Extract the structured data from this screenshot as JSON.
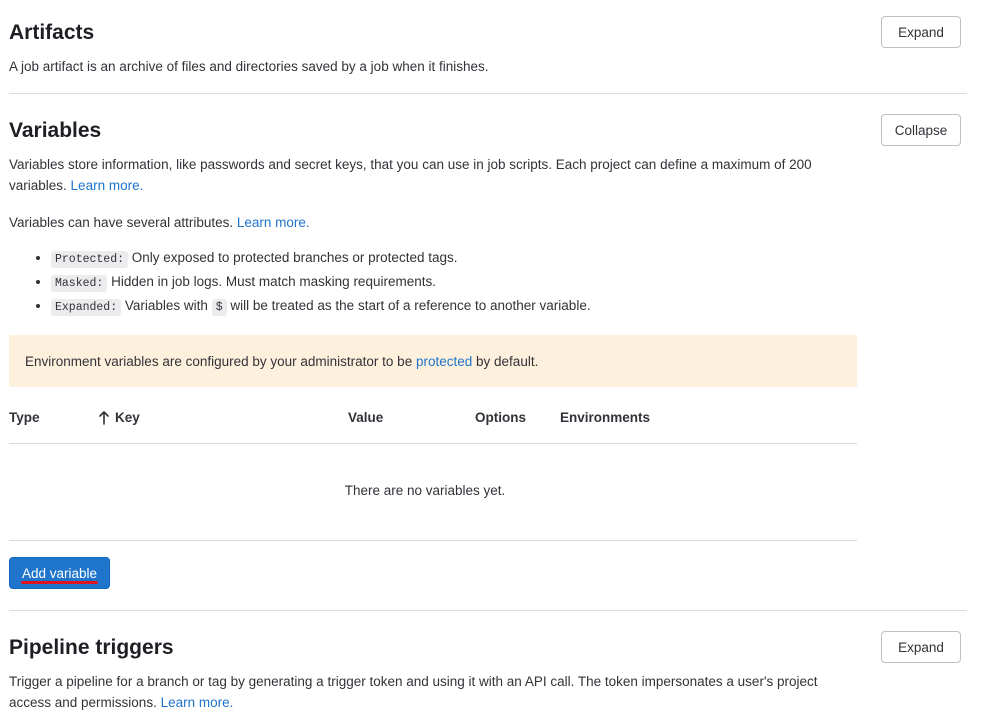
{
  "artifacts": {
    "title": "Artifacts",
    "description": "A job artifact is an archive of files and directories saved by a job when it finishes.",
    "expand_label": "Expand"
  },
  "variables": {
    "title": "Variables",
    "collapse_label": "Collapse",
    "description_1": "Variables store information, like passwords and secret keys, that you can use in job scripts. Each project can define a maximum of 200 variables.",
    "learn_more_1": "Learn more.",
    "description_2": "Variables can have several attributes.",
    "learn_more_2": "Learn more.",
    "attributes": [
      {
        "code": "Protected:",
        "text": "Only exposed to protected branches or protected tags."
      },
      {
        "code": "Masked:",
        "text": "Hidden in job logs. Must match masking requirements."
      },
      {
        "code": "Expanded:",
        "text_before": "Variables with",
        "inline_code": "$",
        "text_after": "will be treated as the start of a reference to another variable."
      }
    ],
    "alert": {
      "before": "Environment variables are configured by your administrator to be",
      "link": "protected",
      "after": "by default."
    },
    "table": {
      "columns": [
        "Type",
        "Key",
        "Value",
        "Options",
        "Environments"
      ],
      "sort_icon": "arrow-up-icon",
      "empty_text": "There are no variables yet."
    },
    "add_label": "Add variable"
  },
  "pipeline_triggers": {
    "title": "Pipeline triggers",
    "description": "Trigger a pipeline for a branch or tag by generating a trigger token and using it with an API call. The token impersonates a user's project access and permissions.",
    "learn_more": "Learn more.",
    "expand_label": "Expand"
  },
  "colors": {
    "primary": "#1f75cb",
    "alert_bg": "#fdf1dd",
    "highlight_underline": "#e0141e"
  }
}
